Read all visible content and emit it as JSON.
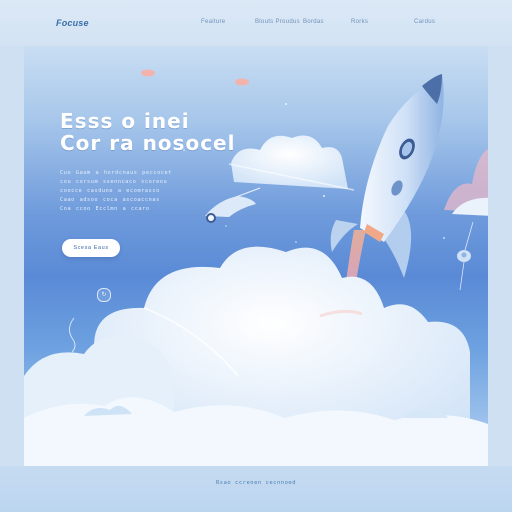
{
  "logo": "Focuse",
  "nav": [
    "Feaiture",
    "Blouts Proudus",
    "Bordas",
    "Rorks",
    "Cardus"
  ],
  "hero": {
    "headline_1": "Esss o inei",
    "headline_2": "Cor ra nosocel",
    "body_lines": [
      "Cuo Gaum a hordcnaus peccocet",
      "cou corsum ssenncaco scoreou",
      "coocce casdune a ecomrasco",
      "Caao adsoo coca ascoaccnas",
      "Coa ccoo Ecclmn a ccaro"
    ],
    "cta_label": "Scesa Eaus",
    "play_icon_glyph": "↻"
  },
  "footer": {
    "text": "Rsao ccrenen cecnnoed"
  },
  "colors": {
    "accent": "#3a6ea8",
    "sky_top": "#c9def3",
    "sky_mid": "#5a8ad6",
    "cloud": "#eef5fd",
    "rocket": "#d6e6f8",
    "flame": "#f4b59a"
  }
}
